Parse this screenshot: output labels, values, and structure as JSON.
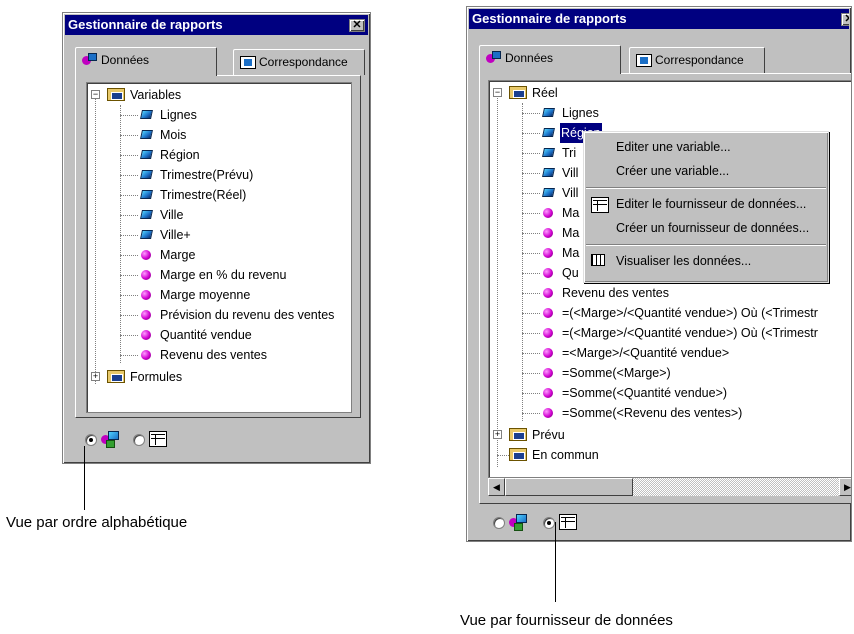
{
  "left": {
    "title": "Gestionnaire de rapports",
    "close": "✕",
    "tabs": [
      "Données",
      "Correspondance"
    ],
    "root": "Variables",
    "variables": [
      "Lignes",
      "Mois",
      "Région",
      "Trimestre(Prévu)",
      "Trimestre(Réel)",
      "Ville",
      "Ville+"
    ],
    "formulas": [
      "Marge",
      "Marge en % du revenu",
      "Marge moyenne",
      "Prévision du revenu des ventes",
      "Quantité vendue",
      "Revenu des ventes"
    ],
    "collapsed": "Formules",
    "selected_view": "alphabetical"
  },
  "right": {
    "title": "Gestionnaire de rapports",
    "close": "✕",
    "tabs": [
      "Données",
      "Correspondance"
    ],
    "root": "Réel",
    "variables": [
      "Lignes",
      "Région",
      "Tri",
      "Vill",
      "Vill"
    ],
    "partial_formulas": [
      "Ma",
      "Ma",
      "Ma",
      "Qu"
    ],
    "formulas": [
      "Revenu des ventes",
      "=(<Marge>/<Quantité vendue>) Où (<Trimestr",
      "=(<Marge>/<Quantité vendue>) Où (<Trimestr",
      "=<Marge>/<Quantité vendue>",
      "=Somme(<Marge>)",
      "=Somme(<Quantité vendue>)",
      "=Somme(<Revenu des ventes>)"
    ],
    "others": [
      "Prévu",
      "En commun"
    ],
    "selected_view": "provider"
  },
  "context_menu": {
    "items": [
      {
        "label": "Editer une variable..."
      },
      {
        "label": "Créer une variable..."
      },
      {
        "label": "Editer le fournisseur de données..."
      },
      {
        "label": "Créer un fournisseur de données..."
      },
      {
        "label": "Visualiser les données..."
      }
    ]
  },
  "captions": {
    "left": "Vue par ordre alphabétique",
    "right": "Vue par fournisseur de données"
  }
}
